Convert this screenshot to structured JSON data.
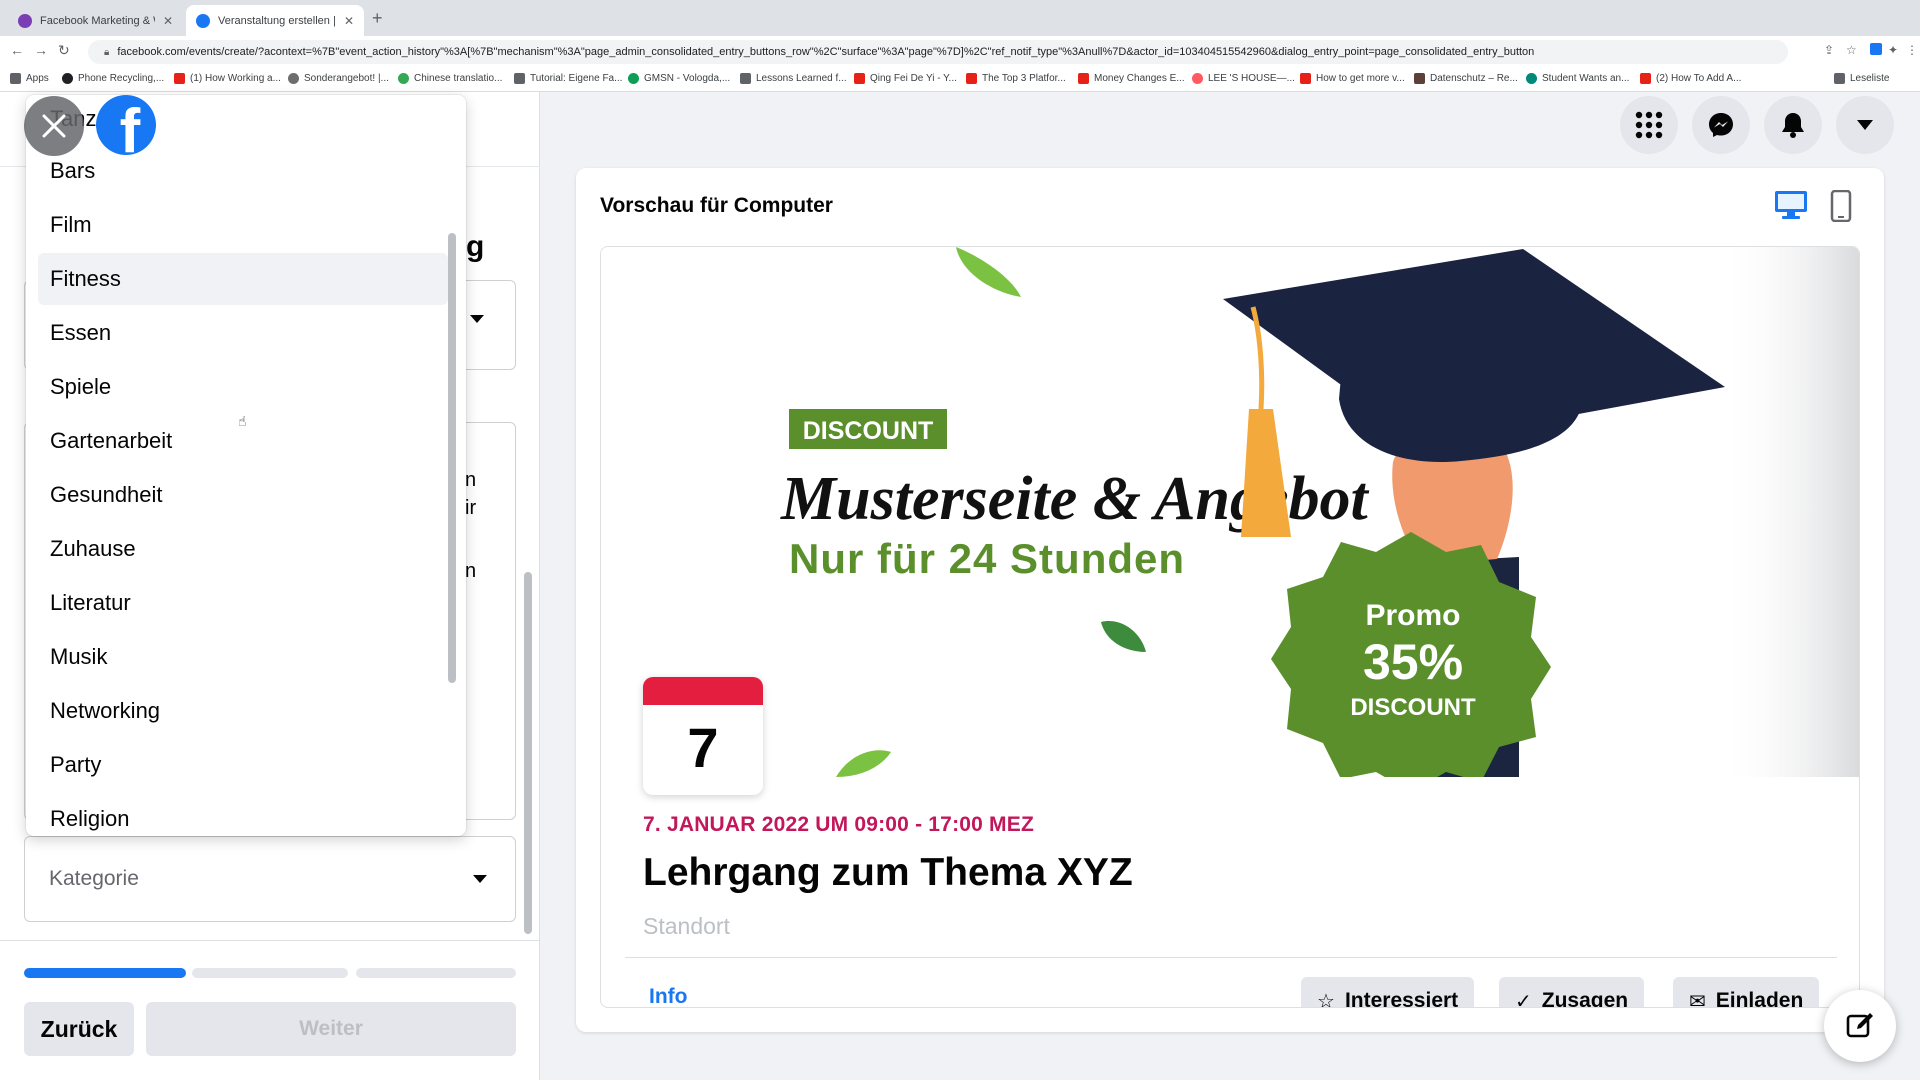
{
  "browser": {
    "tabs": [
      {
        "title": "Facebook Marketing & Werbea",
        "active": false
      },
      {
        "title": "Veranstaltung erstellen | Faceb",
        "active": true
      }
    ],
    "new_tab": "+",
    "url": "facebook.com/events/create/?acontext=%7B\"event_action_history\"%3A[%7B\"mechanism\"%3A\"page_admin_consolidated_entry_buttons_row\"%2C\"surface\"%3A\"page\"%7D]%2C\"ref_notif_type\"%3Anull%7D&actor_id=103404515542960&dialog_entry_point=page_consolidated_entry_button",
    "bookmarks": [
      "Apps",
      "Phone Recycling,...",
      "(1) How Working a...",
      "Sonderangebot! |...",
      "Chinese translatio...",
      "Tutorial: Eigene Fa...",
      "GMSN - Vologda,...",
      "Lessons Learned f...",
      "Qing Fei De Yi - Y...",
      "The Top 3 Platfor...",
      "Money Changes E...",
      "LEE 'S HOUSE—...",
      "How to get more v...",
      "Datenschutz – Re...",
      "Student Wants an...",
      "(2) How To Add A..."
    ],
    "reading_list": "Leseliste"
  },
  "left_panel": {
    "bg_fragments": [
      "g",
      "n",
      "ir",
      "n"
    ],
    "category_placeholder": "Kategorie",
    "back_label": "Zurück",
    "next_label": "Weiter",
    "progress": {
      "step": 1,
      "total": 3
    }
  },
  "dropdown": {
    "partial_top": "Tanz",
    "options": [
      "Bars",
      "Film",
      "Fitness",
      "Essen",
      "Spiele",
      "Gartenarbeit",
      "Gesundheit",
      "Zuhause",
      "Literatur",
      "Musik",
      "Networking",
      "Party",
      "Religion"
    ],
    "hovered": "Fitness"
  },
  "logo_letter": "f",
  "preview": {
    "title": "Vorschau für Computer",
    "cover": {
      "badge": "DISCOUNT",
      "headline": "Musterseite & Angebot",
      "subline": "Nur für 24 Stunden",
      "promo_line1": "Promo",
      "promo_line2": "35%",
      "promo_line3": "DISCOUNT"
    },
    "date_day": "7",
    "date_text": "7. JANUAR 2022 UM 09:00 - 17:00 MEZ",
    "event_name": "Lehrgang zum Thema XYZ",
    "location": "Standort",
    "info_tab": "Info",
    "buttons": {
      "interested": "Interessiert",
      "going": "Zusagen",
      "invite": "Einladen"
    }
  },
  "colors": {
    "accent": "#1877f2",
    "date_red": "#e41e3f",
    "promo_green": "#5a8f2c"
  }
}
